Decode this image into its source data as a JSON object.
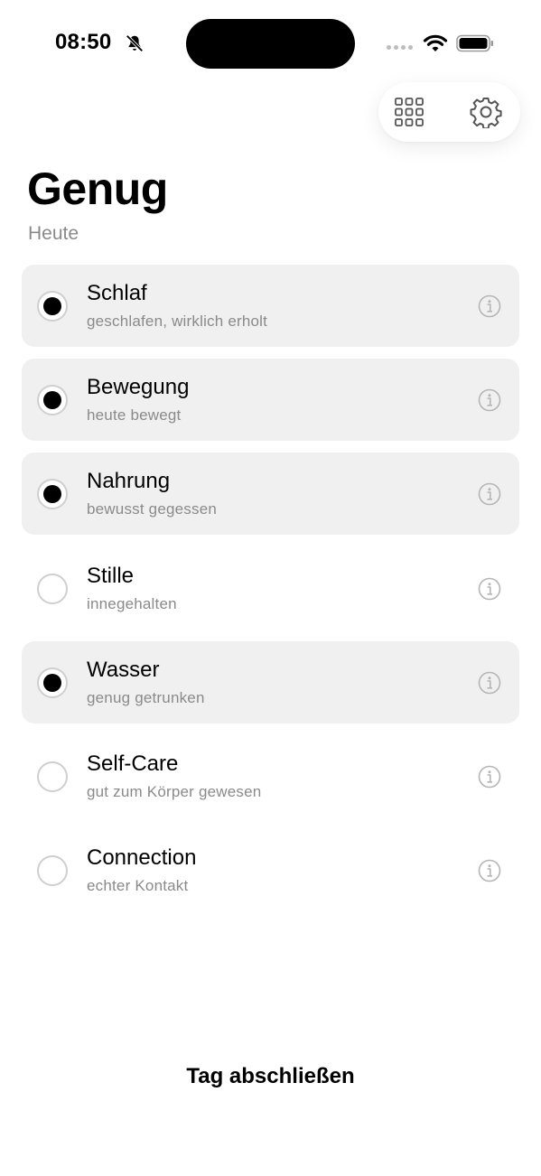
{
  "status_bar": {
    "time": "08:50",
    "icons": [
      "bell-slash-icon",
      "cellular-signal-icon",
      "wifi-icon",
      "battery-icon"
    ]
  },
  "toolbar": {
    "icons": [
      "grid-icon",
      "gear-icon"
    ]
  },
  "header": {
    "title": "Genug",
    "subtitle": "Heute"
  },
  "items": [
    {
      "title": "Schlaf",
      "subtitle": "geschlafen, wirklich erholt",
      "checked": true
    },
    {
      "title": "Bewegung",
      "subtitle": "heute bewegt",
      "checked": true
    },
    {
      "title": "Nahrung",
      "subtitle": "bewusst gegessen",
      "checked": true
    },
    {
      "title": "Stille",
      "subtitle": "innegehalten",
      "checked": false
    },
    {
      "title": "Wasser",
      "subtitle": "genug getrunken",
      "checked": true
    },
    {
      "title": "Self-Care",
      "subtitle": "gut zum Körper gewesen",
      "checked": false
    },
    {
      "title": "Connection",
      "subtitle": "echter Kontakt",
      "checked": false
    }
  ],
  "footer": {
    "action_label": "Tag abschließen"
  },
  "colors": {
    "checked_row_bg": "#f0f0f0",
    "secondary_text": "#8a8a8a",
    "radio_border": "#cfcfcf"
  }
}
